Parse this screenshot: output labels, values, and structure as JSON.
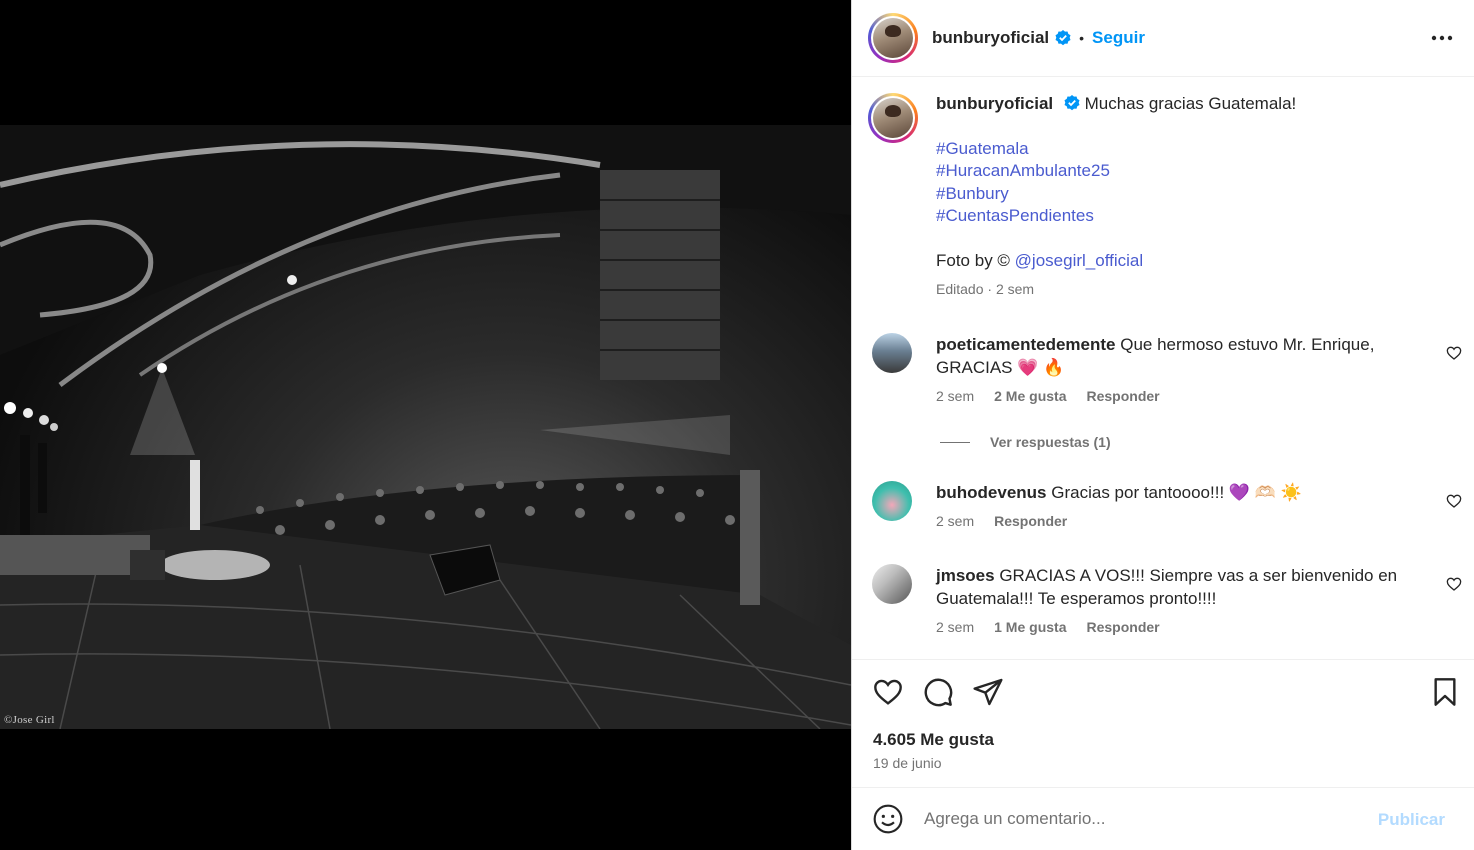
{
  "photo": {
    "credit": "©Jose Girl"
  },
  "header": {
    "username": "bunburyoficial",
    "separator": "•",
    "follow_label": "Seguir",
    "more_icon": "more-horizontal-icon"
  },
  "caption": {
    "username": "bunburyoficial",
    "text": "Muchas gracias Guatemala!",
    "hashtags": [
      "#Guatemala",
      "#HuracanAmbulante25",
      "#Bunbury",
      "#CuentasPendientes"
    ],
    "photo_by_prefix": "Foto by © ",
    "photo_by_mention": "@josegirl_official",
    "edited": "Editado",
    "meta_separator": " · ",
    "time": "2 sem"
  },
  "comments": [
    {
      "username": "poeticamentedemente",
      "text": "Que hermoso estuvo Mr. Enrique, GRACIAS 💗 🔥",
      "time": "2 sem",
      "likes": "2 Me gusta",
      "reply_label": "Responder"
    },
    {
      "username": "buhodevenus",
      "text": "Gracias por tantoooo!!! 💜 🫶🏻 ☀️",
      "time": "2 sem",
      "reply_label": "Responder"
    },
    {
      "username": "jmsoes",
      "text": "GRACIAS A VOS!!! Siempre vas a ser bienvenido en Guatemala!!! Te esperamos pronto!!!!",
      "time": "2 sem",
      "likes": "1 Me gusta",
      "reply_label": "Responder"
    }
  ],
  "replies_label": "Ver respuestas (1)",
  "actions": {
    "like_icon": "heart-icon",
    "comment_icon": "comment-icon",
    "share_icon": "share-icon",
    "save_icon": "bookmark-icon"
  },
  "likes_count": "4.605 Me gusta",
  "post_date": "19 de junio",
  "add_comment": {
    "placeholder": "Agrega un comentario...",
    "publish_label": "Publicar"
  },
  "colors": {
    "link": "#4a5bcf",
    "follow": "#0095f6",
    "publish_disabled": "#b3dbff",
    "verified": "#0095f6"
  }
}
